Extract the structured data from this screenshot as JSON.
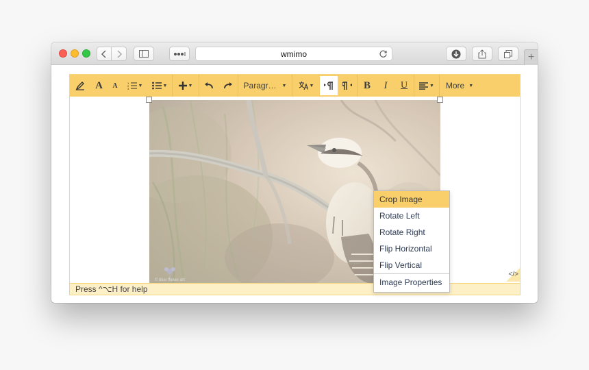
{
  "browser": {
    "address": "wmimo",
    "new_tab_symbol": "+"
  },
  "toolbar": {
    "format_label": "Paragr…",
    "more_label": "More",
    "bold_label": "B",
    "italic_label": "I",
    "underline_label": "U",
    "font_size_up_label": "A",
    "font_size_down_label": "A"
  },
  "context_menu": {
    "items": [
      "Crop Image",
      "Rotate Left",
      "Rotate Right",
      "Flip Horizontal",
      "Flip Vertical",
      "Image Properties"
    ]
  },
  "image": {
    "watermark": "© blue flower art"
  },
  "statusbar": {
    "help_text": "Press ^⌥H for help",
    "code_view_label": "</>"
  },
  "colors": {
    "toolbar": "#f8cf6a",
    "status": "#fdf0c7",
    "highlight": "#f8cf6a"
  }
}
